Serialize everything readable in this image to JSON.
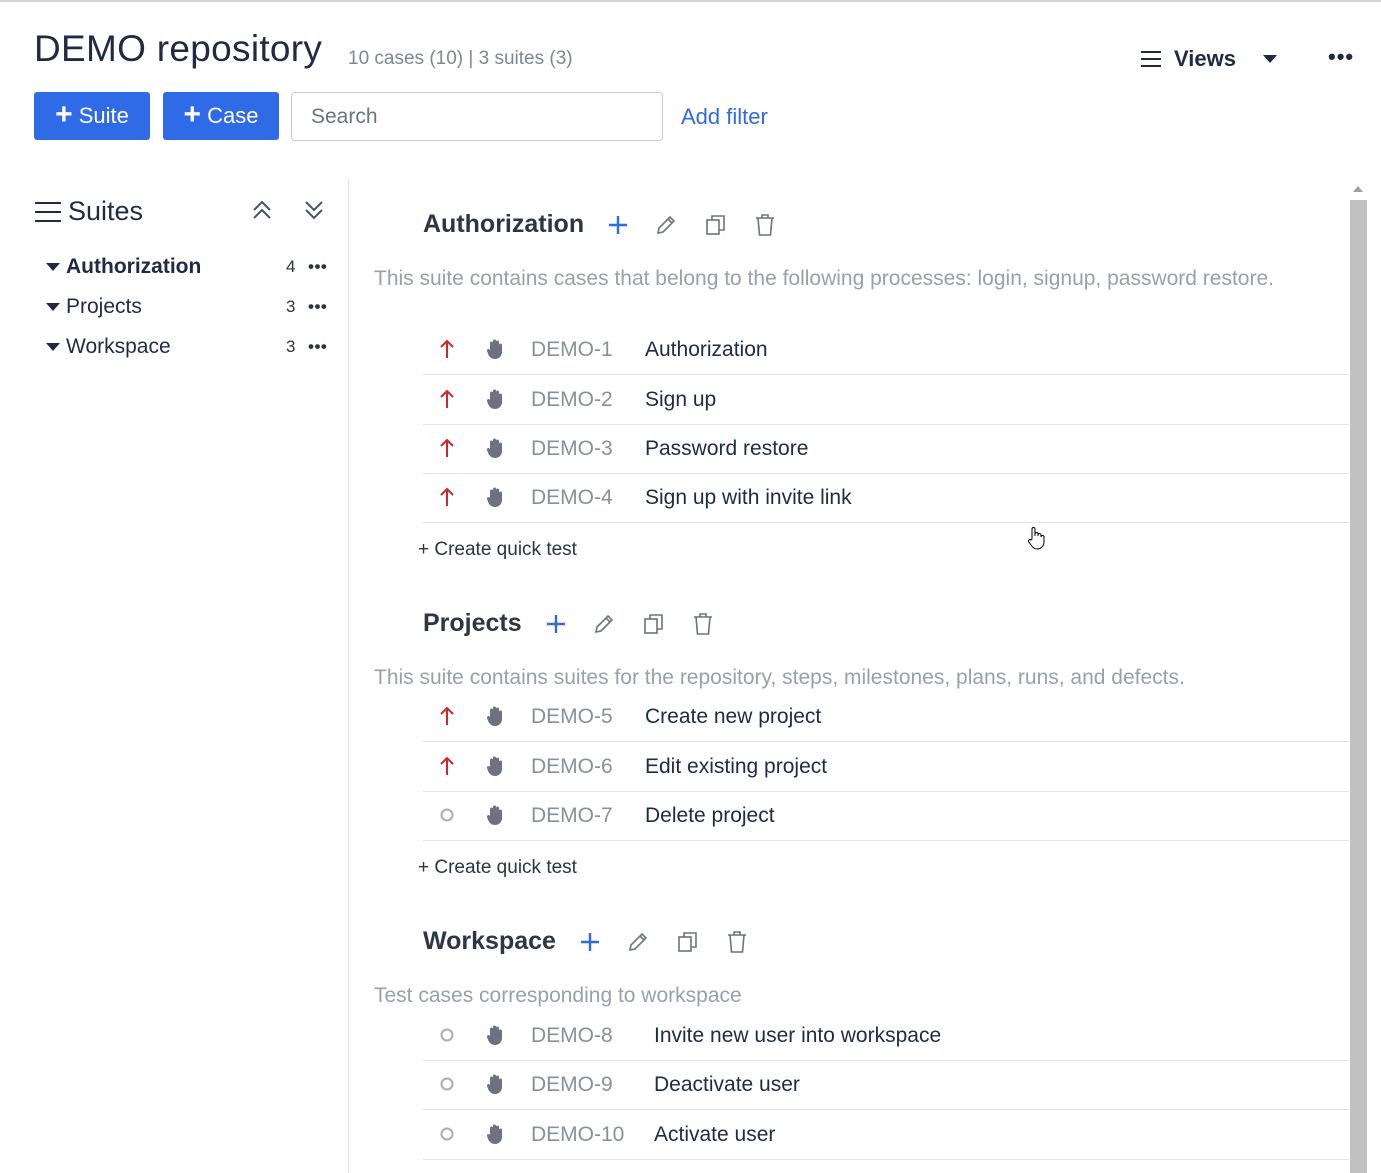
{
  "header": {
    "title": "DEMO repository",
    "meta": "10 cases (10) | 3 suites (3)",
    "views_label": "Views",
    "more_label": "•••"
  },
  "toolbar": {
    "suite_button": "Suite",
    "case_button": "Case",
    "search_placeholder": "Search",
    "add_filter": "Add filter"
  },
  "sidebar": {
    "title": "Suites",
    "items": [
      {
        "label": "Authorization",
        "count": "4",
        "active": true
      },
      {
        "label": "Projects",
        "count": "3",
        "active": false
      },
      {
        "label": "Workspace",
        "count": "3",
        "active": false
      }
    ],
    "dots": "•••"
  },
  "suites": [
    {
      "title": "Authorization",
      "description": "This suite contains cases that belong to the following processes: login, signup, password restore.",
      "cases": [
        {
          "id": "DEMO-1",
          "name": "Authorization",
          "priority": "high"
        },
        {
          "id": "DEMO-2",
          "name": "Sign up",
          "priority": "high"
        },
        {
          "id": "DEMO-3",
          "name": "Password restore",
          "priority": "high"
        },
        {
          "id": "DEMO-4",
          "name": "Sign up with invite link",
          "priority": "high"
        }
      ],
      "quick_test": "+ Create quick test"
    },
    {
      "title": "Projects",
      "description": "This suite contains suites for the repository, steps, milestones, plans, runs, and defects.",
      "cases": [
        {
          "id": "DEMO-5",
          "name": "Create new project",
          "priority": "high"
        },
        {
          "id": "DEMO-6",
          "name": "Edit existing project",
          "priority": "high"
        },
        {
          "id": "DEMO-7",
          "name": "Delete project",
          "priority": "none"
        }
      ],
      "quick_test": "+ Create quick test"
    },
    {
      "title": "Workspace",
      "description": "Test cases corresponding to workspace",
      "cases": [
        {
          "id": "DEMO-8",
          "name": "Invite new user into workspace",
          "priority": "none"
        },
        {
          "id": "DEMO-9",
          "name": "Deactivate user",
          "priority": "none"
        },
        {
          "id": "DEMO-10",
          "name": "Activate user",
          "priority": "none"
        }
      ]
    }
  ],
  "colors": {
    "accent": "#2f6be6",
    "priority_high": "#d0252b",
    "muted": "#9aa0aa"
  }
}
